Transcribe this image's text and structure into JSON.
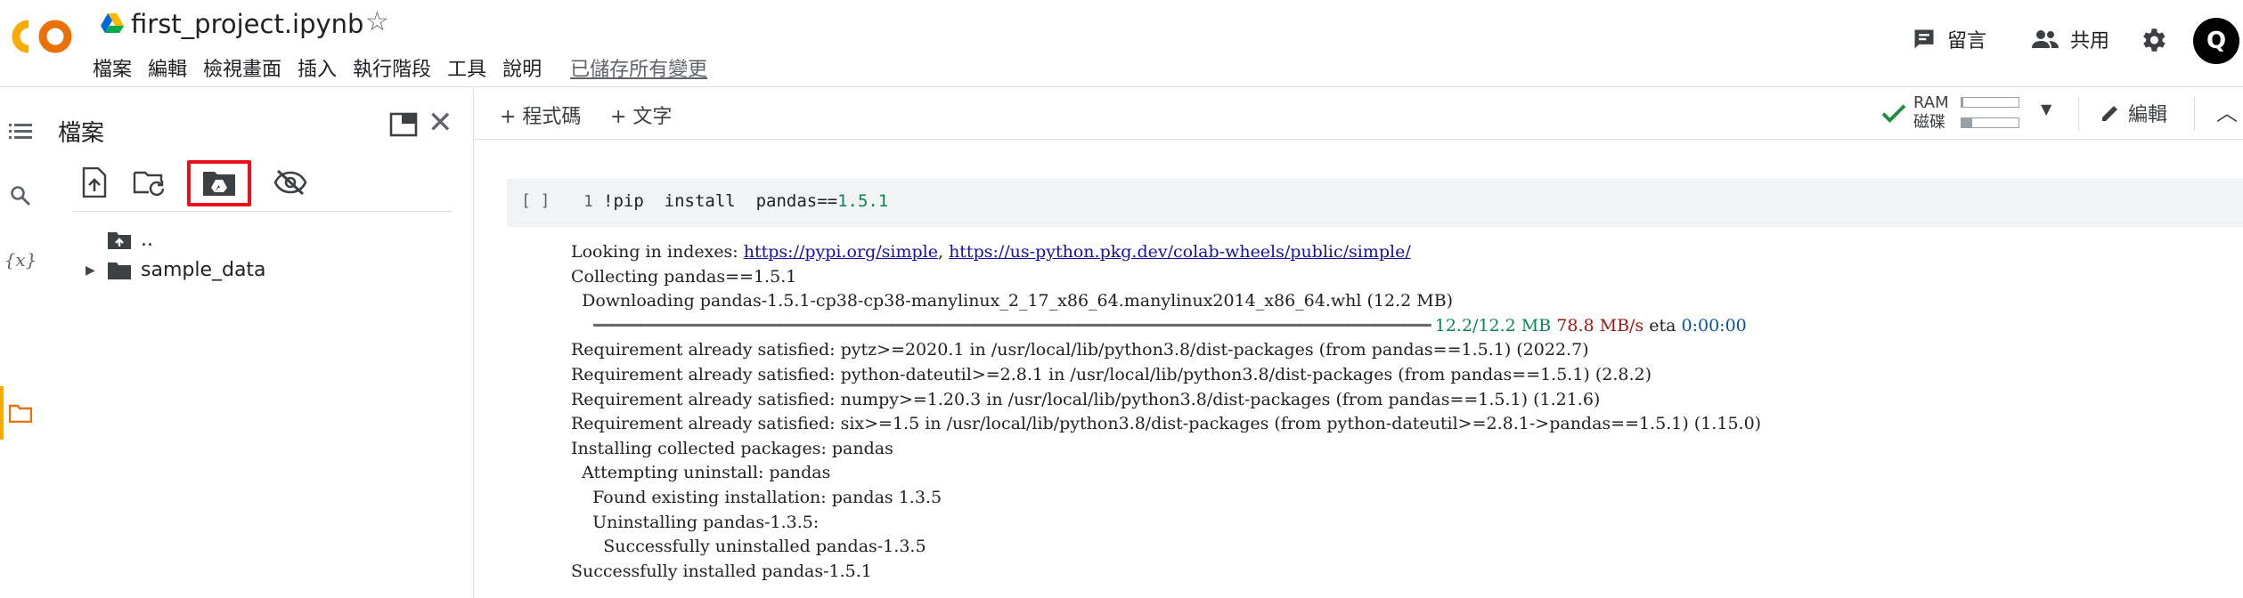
{
  "header": {
    "doc_title": "first_project.ipynb",
    "menu": [
      "檔案",
      "編輯",
      "檢視畫面",
      "插入",
      "執行階段",
      "工具",
      "說明"
    ],
    "saved_status": "已儲存所有變更",
    "comment_label": "留言",
    "share_label": "共用",
    "avatar_text": "Q"
  },
  "filepanel": {
    "title": "檔案",
    "tree": [
      {
        "name": ".."
      },
      {
        "name": "sample_data"
      }
    ]
  },
  "toolbar": {
    "add_code": "+ 程式碼",
    "add_text": "+ 文字",
    "ram_label": "RAM",
    "disk_label": "磁碟",
    "ram_usage": 0.03,
    "disk_usage": 0.18,
    "edit_label": "編輯"
  },
  "cell": {
    "run_label": "[ ]",
    "line_number": "1",
    "code_prefix": "!pip  install  pandas==",
    "code_version": "1.5.1"
  },
  "output": {
    "indexes_prefix": "Looking in indexes: ",
    "index_url_1": "https://pypi.org/simple",
    "indexes_sep": ", ",
    "index_url_2": "https://us-python.pkg.dev/colab-wheels/public/simple/",
    "collecting": "Collecting pandas==1.5.1",
    "downloading": "  Downloading pandas-1.5.1-cp38-cp38-manylinux_2_17_x86_64.manylinux2014_x86_64.whl (12.2 MB)",
    "progress_bar": "     ━━━━━━━━━━━━━━━━━━━━━━━━━━━━━━━━━━━━━━━━━━━━━━━━━━━━━━━━━━━━━━━━━━━━━━━━━━━━━━━━━━━━━━━━━━ ",
    "progress_size": "12.2/12.2 MB",
    "progress_speed": "78.8 MB/s",
    "progress_eta_label": "eta",
    "progress_eta": "0:00:00",
    "lines": [
      "Requirement already satisfied: pytz>=2020.1 in /usr/local/lib/python3.8/dist-packages (from pandas==1.5.1) (2022.7)",
      "Requirement already satisfied: python-dateutil>=2.8.1 in /usr/local/lib/python3.8/dist-packages (from pandas==1.5.1) (2.8.2)",
      "Requirement already satisfied: numpy>=1.20.3 in /usr/local/lib/python3.8/dist-packages (from pandas==1.5.1) (1.21.6)",
      "Requirement already satisfied: six>=1.5 in /usr/local/lib/python3.8/dist-packages (from python-dateutil>=2.8.1->pandas==1.5.1) (1.15.0)",
      "Installing collected packages: pandas",
      "  Attempting uninstall: pandas",
      "    Found existing installation: pandas 1.3.5",
      "    Uninstalling pandas-1.3.5:",
      "      Successfully uninstalled pandas-1.3.5",
      "Successfully installed pandas-1.5.1"
    ]
  },
  "colors": {
    "accent_orange": "#f9ab00",
    "highlight_red": "#e8121b",
    "link_blue": "#1a0dab",
    "ok_green": "#1e8e3e"
  }
}
